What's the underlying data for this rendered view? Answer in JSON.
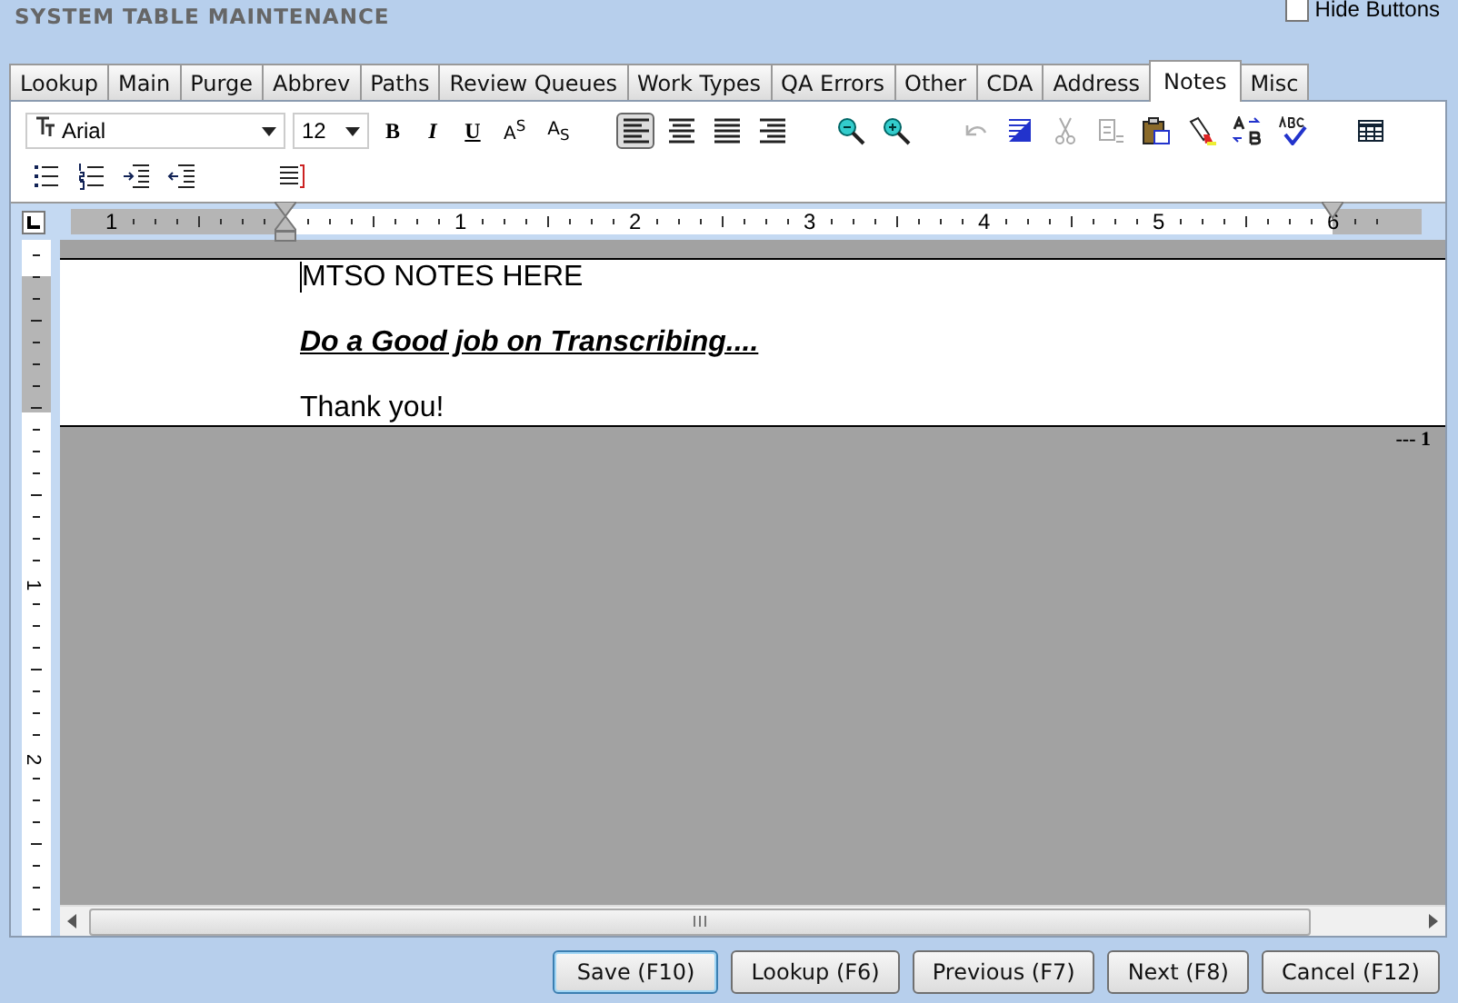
{
  "window": {
    "title": "SYSTEM TABLE MAINTENANCE"
  },
  "hide_buttons": {
    "label": "Hide Buttons",
    "checked": false
  },
  "tabs": [
    {
      "label": "Lookup",
      "selected": false
    },
    {
      "label": "Main",
      "selected": false
    },
    {
      "label": "Purge",
      "selected": false
    },
    {
      "label": "Abbrev",
      "selected": false
    },
    {
      "label": "Paths",
      "selected": false
    },
    {
      "label": "Review Queues",
      "selected": false
    },
    {
      "label": "Work Types",
      "selected": false
    },
    {
      "label": "QA Errors",
      "selected": false
    },
    {
      "label": "Other",
      "selected": false
    },
    {
      "label": "CDA",
      "selected": false
    },
    {
      "label": "Address",
      "selected": false
    },
    {
      "label": "Notes",
      "selected": true
    },
    {
      "label": "Misc",
      "selected": false
    }
  ],
  "toolbar": {
    "font": {
      "value": "Arial"
    },
    "size": {
      "value": "12"
    },
    "format_buttons": [
      "B",
      "I",
      "U",
      "A$^{S}$",
      "A$_{S}$"
    ],
    "align_buttons": [
      {
        "selected": true
      },
      {
        "selected": false
      },
      {
        "selected": false
      },
      {
        "selected": false
      }
    ],
    "edit_buttons": [
      {
        "disabled": true
      },
      {
        "disabled": false
      },
      {
        "disabled": true
      },
      {
        "disabled": true
      },
      {
        "disabled": false
      },
      {
        "disabled": false
      },
      {
        "disabled": false
      },
      {
        "disabled": false
      }
    ]
  },
  "ruler": {
    "labels": [
      "1",
      "1",
      "2",
      "3",
      "4",
      "5",
      "6"
    ]
  },
  "vertical_ruler": {
    "labels": [
      "1",
      "2"
    ]
  },
  "document": {
    "paragraphs": [
      {
        "text": "MTSO NOTES HERE",
        "kind": "plain"
      },
      {
        "text": "Do a Good job on Transcribing....",
        "kind": "emphasis"
      },
      {
        "text": "Thank you!",
        "kind": "plain"
      }
    ],
    "page_marker": "--- 1"
  },
  "buttons": [
    {
      "label": "Save (F10)",
      "default": true
    },
    {
      "label": "Lookup (F6)",
      "default": false
    },
    {
      "label": "Previous (F7)",
      "default": false
    },
    {
      "label": "Next (F8)",
      "default": false
    },
    {
      "label": "Cancel (F12)",
      "default": false
    }
  ]
}
